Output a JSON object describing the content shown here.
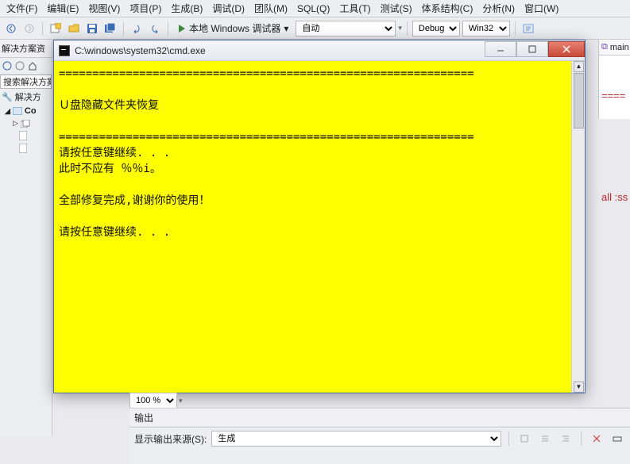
{
  "menu": [
    "文件(F)",
    "编辑(E)",
    "视图(V)",
    "项目(P)",
    "生成(B)",
    "调试(D)",
    "团队(M)",
    "SQL(Q)",
    "工具(T)",
    "测试(S)",
    "体系结构(C)",
    "分析(N)",
    "窗口(W)"
  ],
  "toolbar": {
    "start_label": "本地 Windows 调试器",
    "config_auto": "自动",
    "config_mode": "Debug",
    "config_platform": "Win32"
  },
  "left": {
    "title": "解决方案资",
    "search_placeholder": "搜索解决方案",
    "tree": {
      "root": "解决方",
      "proj": "Co"
    }
  },
  "right": {
    "tab": "main",
    "red_line": "====",
    "red_text": "all :ss \\"
  },
  "cmd": {
    "title": "C:\\windows\\system32\\cmd.exe",
    "lines": "==============================================================\n\nＵ盘隐藏文件夹恢复\n\n==============================================================\n请按任意键继续. . .\n此时不应有 ％％i。\n\n全部修复完成,谢谢你的使用！\n\n请按任意键继续. . ."
  },
  "zoom": "100 %",
  "output": {
    "title": "输出",
    "src_label": "显示输出来源(S):",
    "src_value": "生成"
  }
}
